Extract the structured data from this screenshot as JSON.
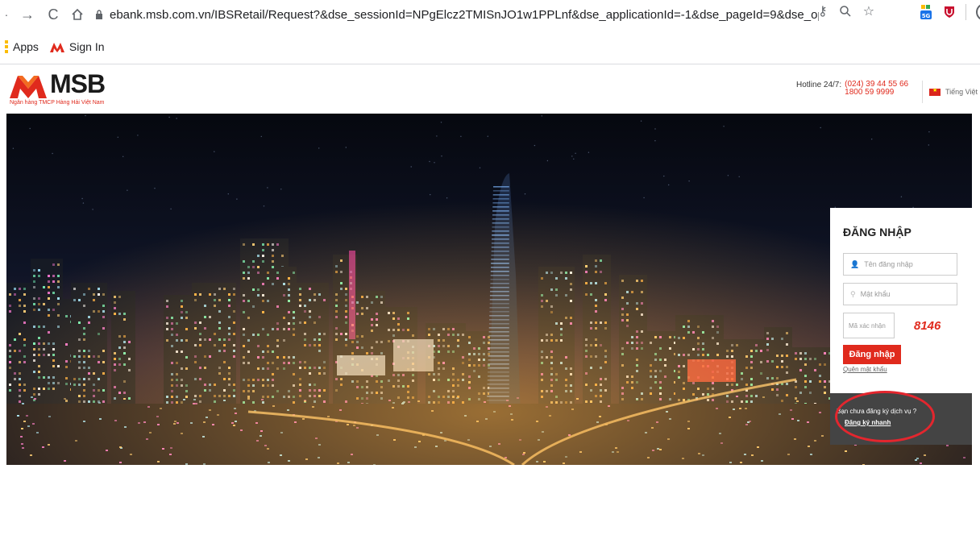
{
  "browser": {
    "url": "ebank.msb.com.vn/IBSRetail/Request?&dse_sessionId=NPgElcz2TMISnJO1w1PPLnf&dse_applicationId=-1&dse_pageId=9&dse_operationName=retai...",
    "back_icon": "arrow-right-icon",
    "bookmarks": [
      {
        "label": "Apps"
      },
      {
        "label": "Sign In"
      }
    ]
  },
  "site": {
    "logo_text": "MSB",
    "logo_subtitle": "Ngân hàng TMCP Hàng Hải Việt Nam",
    "hotline_label": "Hotline 24/7:",
    "hotline_numbers": [
      "(024) 39 44 55 66",
      "1800 59 9999"
    ],
    "language": "Tiếng Việt"
  },
  "login": {
    "title": "ĐĂNG NHẬP",
    "username_placeholder": "Tên đăng nhập",
    "password_placeholder": "Mật khẩu",
    "captcha_placeholder": "Mã xác nhận",
    "captcha_code": "8146",
    "submit_label": "Đăng nhập",
    "forgot_label": "Quên mật khẩu",
    "register_question": "Bạn chưa đăng ký dịch vụ ?",
    "register_link": "Đăng ký nhanh"
  },
  "colors": {
    "brand_red": "#e02a1d",
    "highlight_circle": "#e3262e"
  }
}
